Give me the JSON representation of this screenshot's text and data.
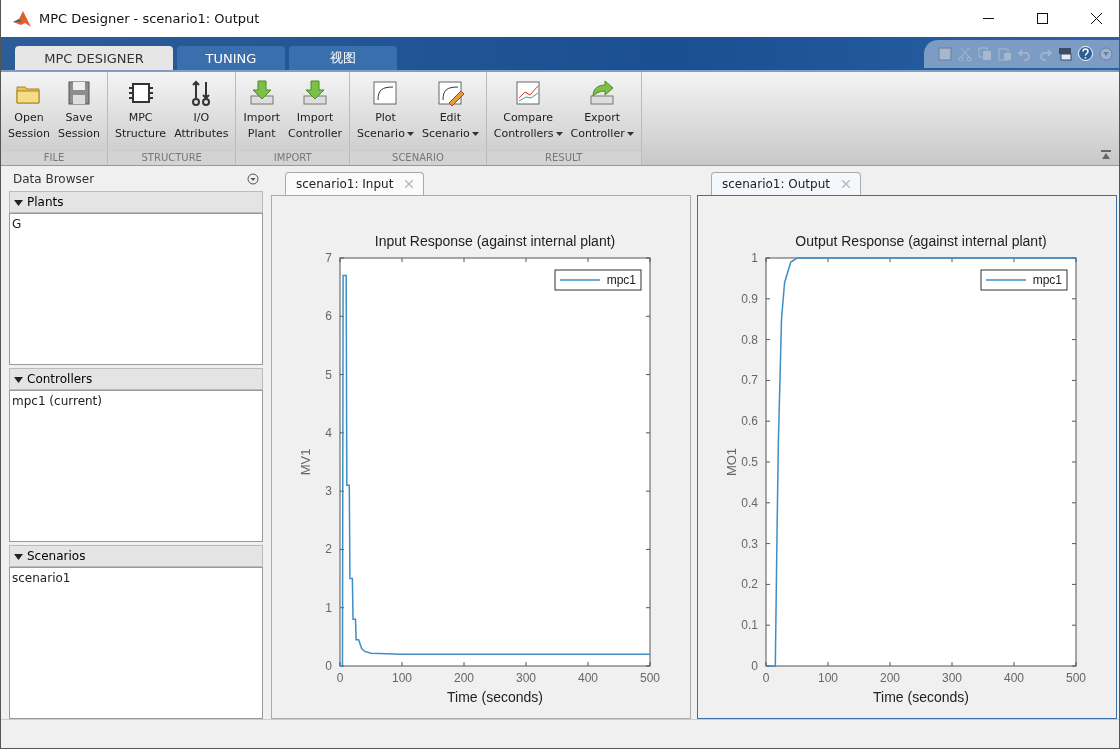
{
  "window": {
    "title": "MPC Designer - scenario1: Output"
  },
  "ribbon_tabs": [
    {
      "label": "MPC DESIGNER",
      "selected": true
    },
    {
      "label": "TUNING",
      "selected": false
    },
    {
      "label": "视图",
      "selected": false
    }
  ],
  "ribbon_groups": [
    {
      "label": "FILE",
      "buttons": [
        {
          "kind": "folder",
          "lines": [
            "Open",
            "Session"
          ],
          "dropdown": false
        },
        {
          "kind": "save",
          "lines": [
            "Save",
            "Session"
          ],
          "dropdown": false
        }
      ]
    },
    {
      "label": "STRUCTURE",
      "buttons": [
        {
          "kind": "chip",
          "lines": [
            "MPC",
            "Structure"
          ],
          "dropdown": false
        },
        {
          "kind": "io",
          "lines": [
            "I/O",
            "Attributes"
          ],
          "dropdown": false
        }
      ]
    },
    {
      "label": "IMPORT",
      "buttons": [
        {
          "kind": "import-g",
          "lines": [
            "Import",
            "Plant"
          ],
          "dropdown": false
        },
        {
          "kind": "import-c",
          "lines": [
            "Import",
            "Controller"
          ],
          "dropdown": false
        }
      ]
    },
    {
      "label": "SCENARIO",
      "buttons": [
        {
          "kind": "plot",
          "lines": [
            "Plot",
            "Scenario"
          ],
          "dropdown": true
        },
        {
          "kind": "edit",
          "lines": [
            "Edit",
            "Scenario"
          ],
          "dropdown": true
        }
      ]
    },
    {
      "label": "RESULT",
      "buttons": [
        {
          "kind": "compare",
          "lines": [
            "Compare",
            "Controllers"
          ],
          "dropdown": true
        },
        {
          "kind": "export",
          "lines": [
            "Export",
            "Controller"
          ],
          "dropdown": true
        }
      ]
    }
  ],
  "data_browser": {
    "title": "Data Browser",
    "sections": [
      {
        "label": "Plants",
        "expanded": true,
        "items": [
          "G"
        ]
      },
      {
        "label": "Controllers",
        "expanded": true,
        "items": [
          "mpc1 (current)"
        ]
      },
      {
        "label": "Scenarios",
        "expanded": true,
        "items": [
          "scenario1"
        ]
      }
    ]
  },
  "documents": [
    {
      "tab": "scenario1: Input",
      "selected": false,
      "chart_data": {
        "type": "line",
        "title": "Input Response (against internal plant)",
        "xlabel": "Time (seconds)",
        "ylabel": "MV1",
        "x": [
          0,
          4,
          5,
          10,
          11,
          15,
          16,
          20,
          21,
          25,
          26,
          30,
          35,
          40,
          50,
          100,
          500
        ],
        "series": [
          {
            "name": "mpc1",
            "color": "#3d8fc6",
            "values": [
              0,
              0,
              6.7,
              6.7,
              3.1,
              3.1,
              1.5,
              1.5,
              0.8,
              0.8,
              0.45,
              0.45,
              0.3,
              0.25,
              0.22,
              0.2,
              0.2
            ]
          }
        ],
        "xlim": [
          0,
          500
        ],
        "ylim": [
          0,
          7
        ],
        "xticks": [
          0,
          100,
          200,
          300,
          400,
          500
        ],
        "yticks": [
          0,
          1,
          2,
          3,
          4,
          5,
          6,
          7
        ]
      }
    },
    {
      "tab": "scenario1: Output",
      "selected": true,
      "chart_data": {
        "type": "line",
        "title": "Output Response (against internal plant)",
        "xlabel": "Time (seconds)",
        "ylabel": "MO1",
        "x": [
          0,
          10,
          15,
          18,
          20,
          25,
          30,
          40,
          50,
          100,
          500
        ],
        "series": [
          {
            "name": "mpc1",
            "color": "#3d8fc6",
            "values": [
              0,
              0,
              0,
              0.35,
              0.55,
              0.85,
              0.94,
              0.99,
              1,
              1,
              1
            ]
          }
        ],
        "xlim": [
          0,
          500
        ],
        "ylim": [
          0,
          1
        ],
        "xticks": [
          0,
          100,
          200,
          300,
          400,
          500
        ],
        "yticks": [
          0,
          0.1,
          0.2,
          0.3,
          0.4,
          0.5,
          0.6,
          0.7,
          0.8,
          0.9,
          1
        ]
      }
    }
  ]
}
